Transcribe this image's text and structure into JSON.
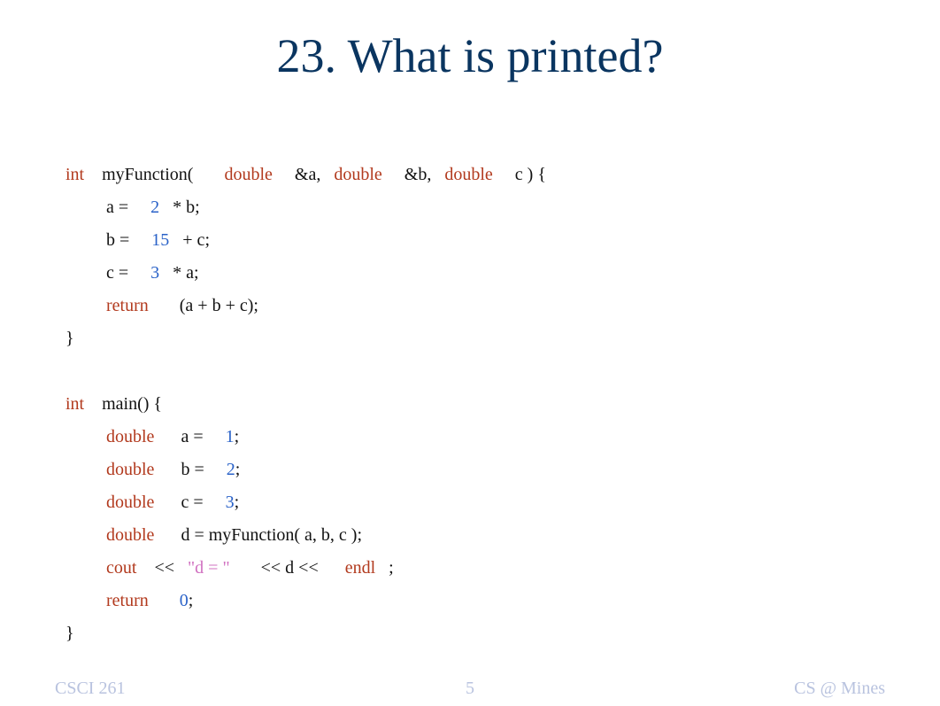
{
  "title": "23.   What is printed?",
  "code": {
    "l1": {
      "int": "int",
      "pre": "    myFunction(       ",
      "dbl": "double",
      "a": "     &a,   ",
      "b": "     &b,   ",
      "c": "     c ) {"
    },
    "l2": {
      "pre": "a =     ",
      "num": "2",
      "post": "   * b;"
    },
    "l3": {
      "pre": "b =     ",
      "num": "15",
      "post": "   + c;"
    },
    "l4": {
      "pre": "c =     ",
      "num": "3",
      "post": "   * a;"
    },
    "l5": {
      "ret": "return",
      "post": "       (a + b + c);"
    },
    "l6": "}",
    "l8": {
      "int": "int",
      "post": "    main() {"
    },
    "l9": {
      "dbl": "double",
      "mid": "      a =     ",
      "num": "1",
      "post": ";"
    },
    "l10": {
      "dbl": "double",
      "mid": "      b =     ",
      "num": "2",
      "post": ";"
    },
    "l11": {
      "dbl": "double",
      "mid": "      c =     ",
      "num": "3",
      "post": ";"
    },
    "l12": {
      "dbl": "double",
      "post": "      d = myFunction( a, b, c );"
    },
    "l13": {
      "cout": "cout",
      "a": "    <<   ",
      "str": "\"d = \"",
      "b": "       << d <<      ",
      "endl": "endl",
      "c": "   ;"
    },
    "l14": {
      "ret": "return",
      "sp": "       ",
      "num": "0",
      "post": ";"
    },
    "l15": "}"
  },
  "footer": {
    "left": "CSCI 261",
    "center": "5",
    "right": "CS @ Mines"
  }
}
